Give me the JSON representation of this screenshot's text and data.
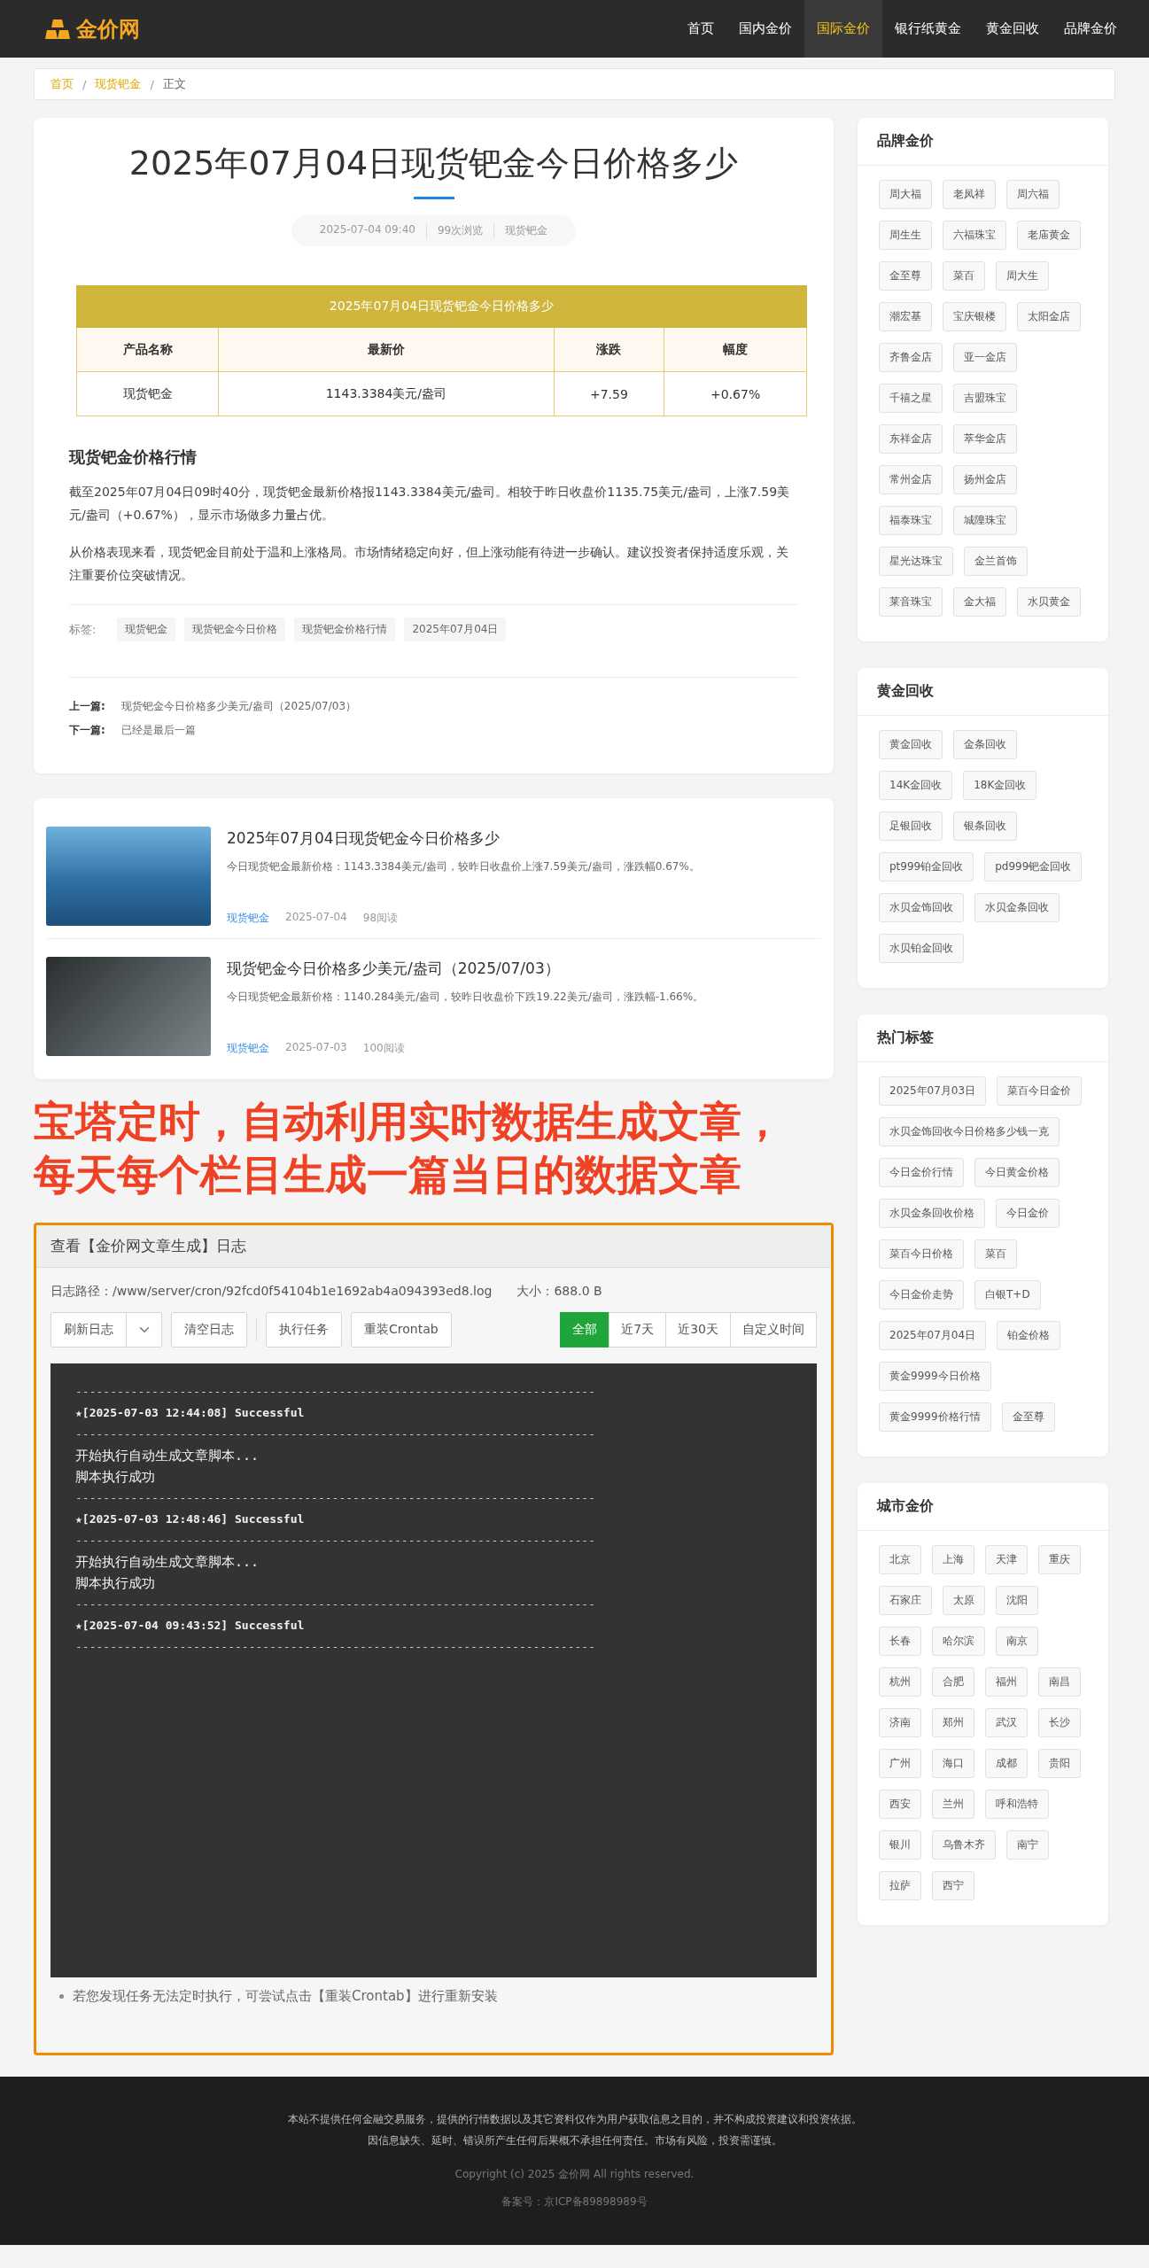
{
  "nav": {
    "logo": "金价网",
    "items": [
      {
        "label": "首页",
        "selected": false
      },
      {
        "label": "国内金价",
        "selected": false
      },
      {
        "label": "国际金价",
        "selected": true
      },
      {
        "label": "银行纸黄金",
        "selected": false
      },
      {
        "label": "黄金回收",
        "selected": false
      },
      {
        "label": "品牌金价",
        "selected": false
      }
    ]
  },
  "breadcrumb": {
    "separator": "/",
    "items": [
      {
        "label": "首页",
        "kind": "link"
      },
      {
        "label": "现货钯金",
        "kind": "link"
      },
      {
        "label": "正文",
        "kind": "current"
      }
    ]
  },
  "article": {
    "title": "2025年07月04日现货钯金今日价格多少",
    "meta": [
      "2025-07-04 09:40",
      "99次浏览",
      "现货钯金"
    ],
    "price_table": {
      "caption": "2025年07月04日现货钯金今日价格多少",
      "columns": [
        "产品名称",
        "最新价",
        "涨跌",
        "幅度"
      ],
      "rows": [
        [
          "现货钯金",
          "1143.3384美元/盎司",
          "+7.59",
          "+0.67%"
        ]
      ]
    },
    "section_heading": "现货钯金价格行情",
    "paragraphs": [
      "截至2025年07月04日09时40分，现货钯金最新价格报1143.3384美元/盎司。相较于昨日收盘价1135.75美元/盎司，上涨7.59美元/盎司（+0.67%），显示市场做多力量占优。",
      "从价格表现来看，现货钯金目前处于温和上涨格局。市场情绪稳定向好，但上涨动能有待进一步确认。建议投资者保持适度乐观，关注重要价位突破情况。"
    ],
    "tags_label": "标签:",
    "tags": [
      "现货钯金",
      "现货钯金今日价格",
      "现货钯金价格行情",
      "2025年07月04日"
    ],
    "prev": {
      "label": "上一篇:",
      "title": "现货钯金今日价格多少美元/盎司（2025/07/03）"
    },
    "next": {
      "label": "下一篇:",
      "title": "已经是最后一篇"
    }
  },
  "related": [
    {
      "title": "2025年07月04日现货钯金今日价格多少",
      "summary": "今日现货钯金最新价格：1143.3384美元/盎司，较昨日收盘价上涨7.59美元/盎司，涨跌幅0.67%。",
      "category": "现货钯金",
      "date": "2025-07-04",
      "views": "98阅读",
      "kind": "sea"
    },
    {
      "title": "现货钯金今日价格多少美元/盎司（2025/07/03）",
      "summary": "今日现货钯金最新价格：1140.284美元/盎司，较昨日收盘价下跌19.22美元/盎司，涨跌幅-1.66%。",
      "category": "现货钯金",
      "date": "2025-07-03",
      "views": "100阅读",
      "kind": "dark"
    }
  ],
  "caption": [
    "宝塔定时，自动利用实时数据生成文章，",
    "每天每个栏目生成一篇当日的数据文章"
  ],
  "log_panel": {
    "title": "查看【金价网文章生成】日志",
    "path_label": "日志路径：",
    "path": "/www/server/cron/92fcd0f54104b1e1692ab4a094393ed8.log",
    "size_label": "大小：",
    "size": "688.0 B",
    "buttons": [
      "刷新日志",
      "清空日志",
      "执行任务",
      "重装Crontab"
    ],
    "filters": [
      {
        "label": "全部",
        "selected": true
      },
      {
        "label": "近7天",
        "selected": false
      },
      {
        "label": "近30天",
        "selected": false
      },
      {
        "label": "自定义时间",
        "selected": false
      }
    ],
    "lines": [
      {
        "kind": "rule",
        "text": "---------------------------------------------------------------------------"
      },
      {
        "kind": "entry",
        "text": "★[2025-07-03 12:44:08] Successful"
      },
      {
        "kind": "rule",
        "text": "---------------------------------------------------------------------------"
      },
      {
        "kind": "text",
        "text": "开始执行自动生成文章脚本..."
      },
      {
        "kind": "text",
        "text": "脚本执行成功"
      },
      {
        "kind": "rule",
        "text": "---------------------------------------------------------------------------"
      },
      {
        "kind": "entry",
        "text": "★[2025-07-03 12:48:46] Successful"
      },
      {
        "kind": "rule",
        "text": "---------------------------------------------------------------------------"
      },
      {
        "kind": "text",
        "text": "开始执行自动生成文章脚本..."
      },
      {
        "kind": "text",
        "text": "脚本执行成功"
      },
      {
        "kind": "rule",
        "text": "---------------------------------------------------------------------------"
      },
      {
        "kind": "entry",
        "text": "★[2025-07-04 09:43:52] Successful"
      },
      {
        "kind": "rule",
        "text": "---------------------------------------------------------------------------"
      }
    ],
    "note": "若您发现任务无法定时执行，可尝试点击【重装Crontab】进行重新安装"
  },
  "sidebar": [
    {
      "title": "品牌金价",
      "tags": [
        "周大福",
        "老凤祥",
        "周六福",
        "周生生",
        "六福珠宝",
        "老庙黄金",
        "金至尊",
        "菜百",
        "周大生",
        "潮宏基",
        "宝庆银楼",
        "太阳金店",
        "齐鲁金店",
        "亚一金店",
        "千禧之星",
        "吉盟珠宝",
        "东祥金店",
        "萃华金店",
        "常州金店",
        "扬州金店",
        "福泰珠宝",
        "城隍珠宝",
        "星光达珠宝",
        "金兰首饰",
        "莱音珠宝",
        "金大福",
        "水贝黄金"
      ]
    },
    {
      "title": "黄金回收",
      "tags": [
        "黄金回收",
        "金条回收",
        "14K金回收",
        "18K金回收",
        "足银回收",
        "银条回收",
        "pt999铂金回收",
        "pd999钯金回收",
        "水贝金饰回收",
        "水贝金条回收",
        "水贝铂金回收"
      ]
    },
    {
      "title": "热门标签",
      "tags": [
        "2025年07月03日",
        "菜百今日金价",
        "水贝金饰回收今日价格多少钱一克",
        "今日金价行情",
        "今日黄金价格",
        "水贝金条回收价格",
        "今日金价",
        "菜百今日价格",
        "菜百",
        "今日金价走势",
        "白银T+D",
        "2025年07月04日",
        "铂金价格",
        "黄金9999今日价格",
        "黄金9999价格行情",
        "金至尊"
      ]
    },
    {
      "title": "城市金价",
      "tags": [
        "北京",
        "上海",
        "天津",
        "重庆",
        "石家庄",
        "太原",
        "沈阳",
        "长春",
        "哈尔滨",
        "南京",
        "杭州",
        "合肥",
        "福州",
        "南昌",
        "济南",
        "郑州",
        "武汉",
        "长沙",
        "广州",
        "海口",
        "成都",
        "贵阳",
        "西安",
        "兰州",
        "呼和浩特",
        "银川",
        "乌鲁木齐",
        "南宁",
        "拉萨",
        "西宁"
      ]
    }
  ],
  "footer": {
    "disclaimer": [
      "本站不提供任何金融交易服务，提供的行情数据以及其它资料仅作为用户获取信息之目的，并不构成投资建议和投资依据。",
      "因信息缺失、延时、错误所产生任何后果概不承担任何责任。市场有风险，投资需谨慎。"
    ],
    "copyright": "Copyright (c) 2025 金价网 All rights reserved.",
    "icp": "备案号：京ICP备89898989号"
  }
}
